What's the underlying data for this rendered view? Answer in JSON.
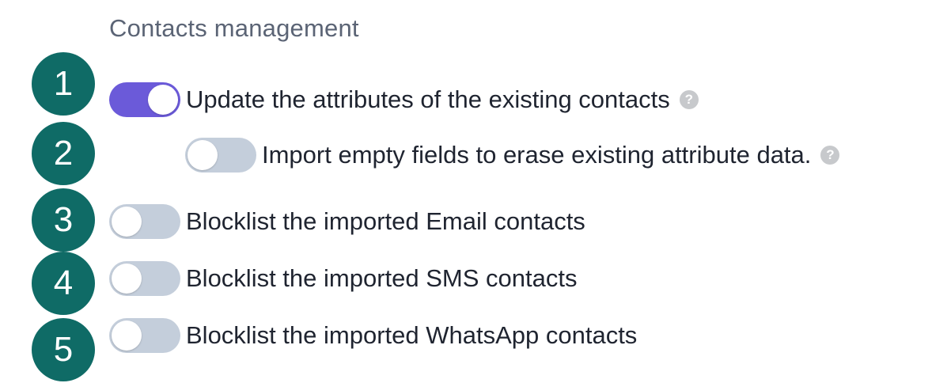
{
  "section": {
    "title": "Contacts management"
  },
  "options": [
    {
      "badge": "1",
      "label": "Update the attributes of the existing contacts",
      "enabled": true,
      "has_help": true,
      "help_icon": "question-circle-icon"
    },
    {
      "badge": "2",
      "label": "Import empty fields to erase existing attribute data.",
      "enabled": false,
      "has_help": true,
      "help_icon": "question-circle-icon"
    },
    {
      "badge": "3",
      "label": "Blocklist the imported Email contacts",
      "enabled": false,
      "has_help": false
    },
    {
      "badge": "4",
      "label": "Blocklist the imported SMS contacts",
      "enabled": false,
      "has_help": false
    },
    {
      "badge": "5",
      "label": "Blocklist the imported WhatsApp contacts",
      "enabled": false,
      "has_help": false
    }
  ],
  "help_glyph": "?",
  "colors": {
    "badge": "#0f6b66",
    "toggle_on": "#6b5ad9",
    "toggle_off": "#c4cedb",
    "title": "#5b6475",
    "text": "#1f2430"
  }
}
